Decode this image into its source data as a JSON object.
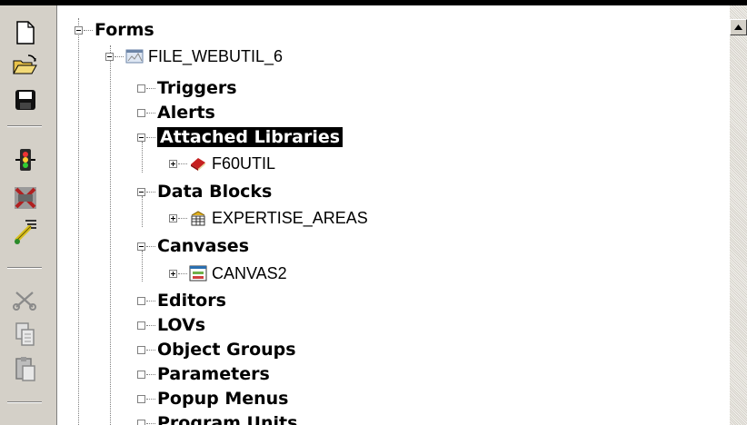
{
  "tree": {
    "root": {
      "label": "Forms"
    },
    "module": {
      "label": "FILE_WEBUTIL_6"
    },
    "items": [
      {
        "label": "Triggers"
      },
      {
        "label": "Alerts"
      },
      {
        "label": "Attached Libraries",
        "child": "F60UTIL"
      },
      {
        "label": "Data Blocks",
        "child": "EXPERTISE_AREAS"
      },
      {
        "label": "Canvases",
        "child": "CANVAS2"
      },
      {
        "label": "Editors"
      },
      {
        "label": "LOVs"
      },
      {
        "label": "Object Groups"
      },
      {
        "label": "Parameters"
      },
      {
        "label": "Popup Menus"
      },
      {
        "label": "Program Units"
      }
    ]
  },
  "toolbar": {
    "buttons": [
      "new-icon",
      "open-icon",
      "save-icon",
      "run-icon",
      "compile-icon",
      "debug-icon",
      "cut-icon",
      "copy-icon",
      "paste-icon"
    ]
  },
  "colors": {
    "selection_bg": "#000000",
    "toolbar_bg": "#d4d0c8"
  }
}
